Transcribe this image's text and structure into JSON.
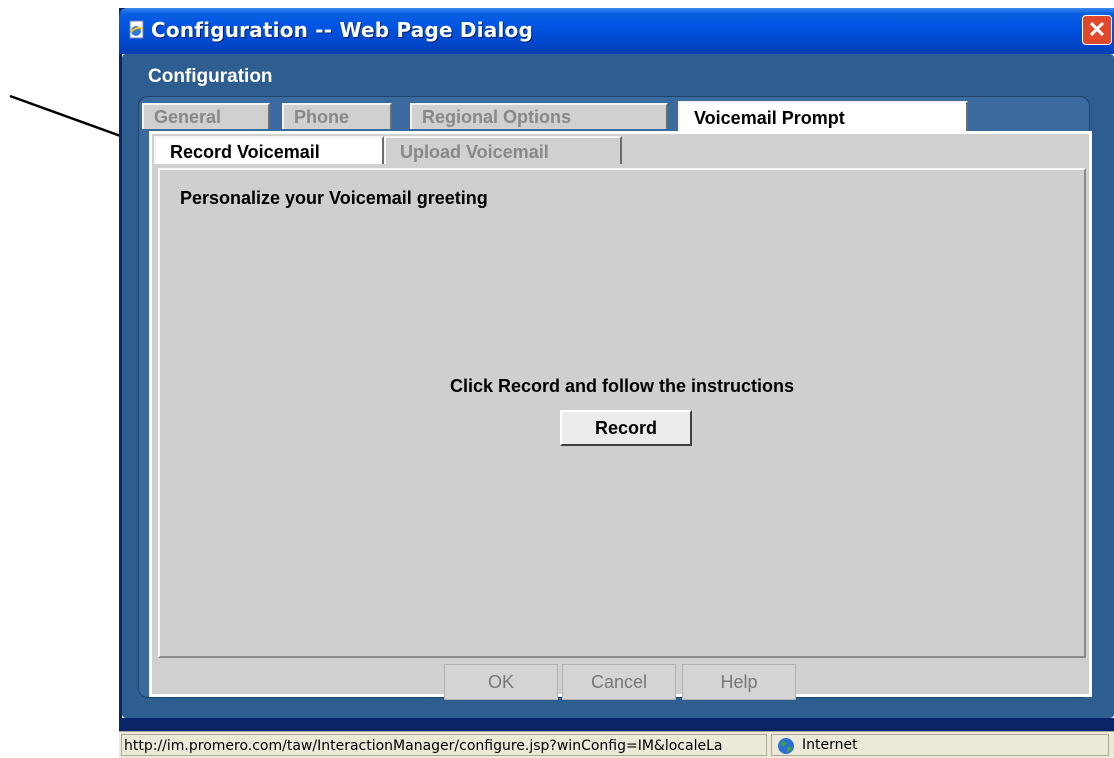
{
  "window": {
    "title": "Configuration -- Web Page Dialog",
    "close_symbol": "✕",
    "close_icon": "close-icon",
    "title_icon": "ie-page-icon"
  },
  "panel": {
    "title": "Configuration"
  },
  "tabs": [
    {
      "label": "General",
      "active": false
    },
    {
      "label": "Phone",
      "active": false
    },
    {
      "label": "Regional Options",
      "active": false
    },
    {
      "label": "Voicemail Prompt",
      "active": true
    }
  ],
  "subtabs": [
    {
      "label": "Record Voicemail",
      "active": true
    },
    {
      "label": "Upload Voicemail",
      "active": false
    }
  ],
  "record": {
    "heading": "Personalize your Voicemail greeting",
    "instructions": "Click Record and follow the instructions",
    "button_label": "Record"
  },
  "buttons": {
    "ok": "OK",
    "cancel": "Cancel",
    "help": "Help"
  },
  "statusbar": {
    "url": "http://im.promero.com/taw/InteractionManager/configure.jsp?winConfig=IM&localeLa",
    "zone": "Internet",
    "zone_icon": "globe-icon"
  },
  "colors": {
    "titlebar": "#0054e3",
    "panel": "#2e5d8f",
    "tab_active": "#ffffff",
    "tab_inactive": "#d0d0d0",
    "body": "#cfcfcf"
  }
}
